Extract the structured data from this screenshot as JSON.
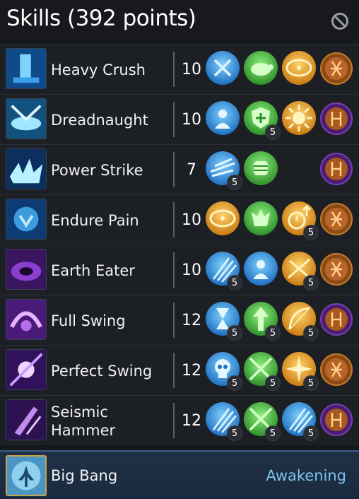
{
  "header": {
    "title": "Skills (392 points)",
    "disabled_icon": "prohibited-icon"
  },
  "skills": [
    {
      "name": "Heavy Crush",
      "level": "10",
      "icon": "heavy-crush-skill-icon",
      "tripods": [
        {
          "icon": "arrows-cross-icon",
          "badge": ""
        },
        {
          "icon": "turtle-icon",
          "badge": ""
        },
        {
          "icon": "target-arrows-icon",
          "badge": ""
        }
      ],
      "rune": "orange-rune"
    },
    {
      "name": "Dreadnaught",
      "level": "10",
      "icon": "dreadnaught-skill-icon",
      "tripods": [
        {
          "icon": "person-aura-icon",
          "badge": ""
        },
        {
          "icon": "shield-plus-icon",
          "badge": "5"
        },
        {
          "icon": "sun-burst-icon",
          "badge": ""
        }
      ],
      "rune": "purple-rune"
    },
    {
      "name": "Power Strike",
      "level": "7",
      "icon": "power-strike-skill-icon",
      "tripods": [
        {
          "icon": "dash-blade-icon",
          "badge": "5"
        },
        {
          "icon": "fist-icon",
          "badge": ""
        }
      ],
      "rune": "purple-rune"
    },
    {
      "name": "Endure Pain",
      "level": "10",
      "icon": "endure-pain-skill-icon",
      "tripods": [
        {
          "icon": "target-arrows-icon",
          "badge": ""
        },
        {
          "icon": "creature-icon",
          "badge": ""
        },
        {
          "icon": "stopwatch-up-icon",
          "badge": "5"
        }
      ],
      "rune": "orange-rune"
    },
    {
      "name": "Earth Eater",
      "level": "10",
      "icon": "earth-eater-skill-icon",
      "tripods": [
        {
          "icon": "triple-slash-icon",
          "badge": "5"
        },
        {
          "icon": "person-aura-icon",
          "badge": ""
        },
        {
          "icon": "crossed-slash-icon",
          "badge": "5"
        }
      ],
      "rune": "orange-rune"
    },
    {
      "name": "Full Swing",
      "level": "12",
      "icon": "full-swing-skill-icon",
      "tripods": [
        {
          "icon": "hourglass-icon",
          "badge": "5"
        },
        {
          "icon": "up-arrow-icon",
          "badge": "5"
        },
        {
          "icon": "bow-icon",
          "badge": "5"
        }
      ],
      "rune": "purple-rune"
    },
    {
      "name": "Perfect Swing",
      "level": "12",
      "icon": "perfect-swing-skill-icon",
      "tripods": [
        {
          "icon": "skull-icon",
          "badge": "5"
        },
        {
          "icon": "crossed-swords-icon",
          "badge": "5"
        },
        {
          "icon": "spark-burst-icon",
          "badge": "5"
        }
      ],
      "rune": "orange-rune"
    },
    {
      "name": "Seismic Hammer",
      "level": "12",
      "icon": "seismic-hammer-skill-icon",
      "tripods": [
        {
          "icon": "triple-slash-icon",
          "badge": "5"
        },
        {
          "icon": "crossed-swords-icon",
          "badge": "5"
        },
        {
          "icon": "triple-slash-icon",
          "badge": "5"
        }
      ],
      "rune": "purple-rune"
    }
  ],
  "awakening": {
    "name": "Big Bang",
    "label": "Awakening",
    "icon": "big-bang-skill-icon"
  },
  "colors": {
    "blue": "#2f8fe0",
    "green": "#3fbf3a",
    "orange": "#e0951e",
    "purple_rune": "#5b2a8a",
    "orange_rune": "#b0601e",
    "awakening_text": "#7cc3ee"
  }
}
